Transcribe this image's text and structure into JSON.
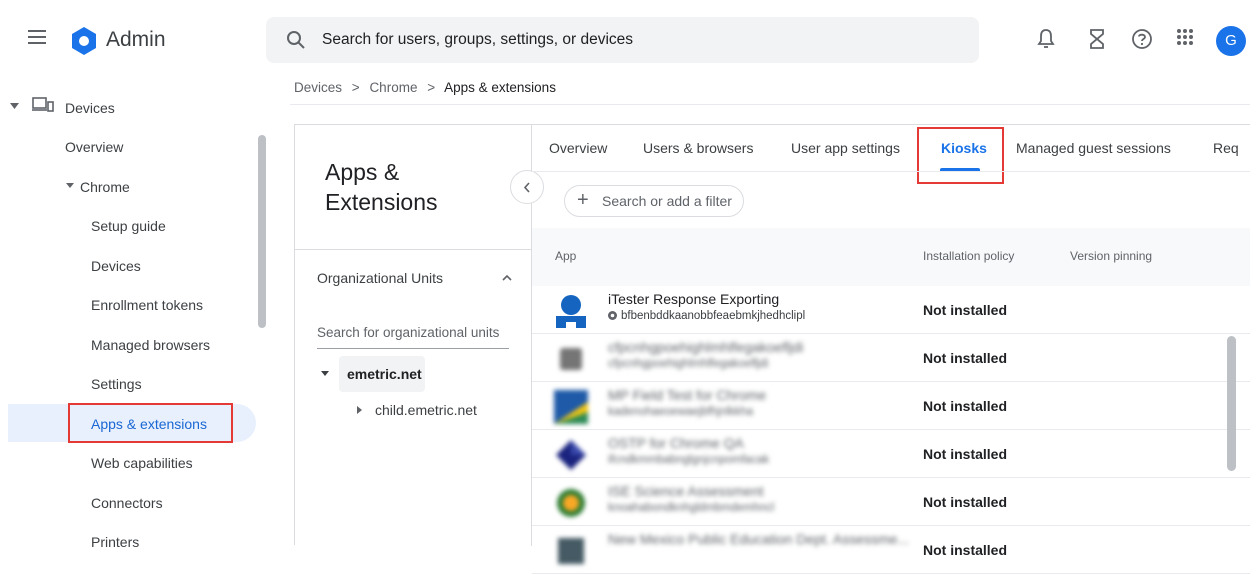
{
  "app": {
    "title": "Admin",
    "avatar_letter": "G"
  },
  "search": {
    "placeholder": "Search for users, groups, settings, or devices"
  },
  "breadcrumb": {
    "items": [
      "Devices",
      "Chrome"
    ],
    "current": "Apps & extensions",
    "separator": ">"
  },
  "sidebar": {
    "section": "Devices",
    "overview": "Overview",
    "chrome": "Chrome",
    "items": [
      "Setup guide",
      "Devices",
      "Enrollment tokens",
      "Managed browsers",
      "Settings",
      "Apps & extensions",
      "Web capabilities",
      "Connectors",
      "Printers"
    ],
    "active_index": 5
  },
  "panel": {
    "title": "Apps & Extensions",
    "ou_header": "Organizational Units",
    "ou_search_placeholder": "Search for organizational units",
    "ou_root": "emetric.net",
    "ou_child": "child.emetric.net"
  },
  "tabs": [
    {
      "label": "Overview"
    },
    {
      "label": "Users & browsers"
    },
    {
      "label": "User app settings"
    },
    {
      "label": "Kiosks",
      "active": true
    },
    {
      "label": "Managed guest sessions"
    },
    {
      "label": "Req"
    }
  ],
  "filter": {
    "label": "Search or add a filter"
  },
  "table": {
    "columns": [
      "App",
      "Installation policy",
      "Version pinning"
    ],
    "rows": [
      {
        "name": "iTester Response Exporting",
        "id": "bfbenbddkaanobbfeaebmkjhedhclipl",
        "policy": "Not installed",
        "icon": "itester-icon"
      },
      {
        "name": "cfpcnhgpoehighlmhlfegakoefljdi",
        "id": "cfpcnhgpoehighlmhlfegakoefljdi",
        "policy": "Not installed",
        "icon": "gray-app-icon"
      },
      {
        "name": "MP Field Test for Chrome",
        "id": "kadenohaeoewaejbfhjnlkkha",
        "policy": "Not installed",
        "icon": "field-test-icon"
      },
      {
        "name": "OSTP for Chrome QA",
        "id": "ifcndkmmbabnglgnjcnpomfacak",
        "policy": "Not installed",
        "icon": "diamond-app-icon"
      },
      {
        "name": "ISE Science Assessment",
        "id": "knoahabondknhgldmbmdemhncl",
        "policy": "Not installed",
        "icon": "science-app-icon"
      },
      {
        "name": "New Mexico Public Education Dept. Assessme...",
        "id": "",
        "policy": "Not installed",
        "icon": "nm-app-icon"
      }
    ]
  },
  "colors": {
    "accent": "#1a73e8",
    "highlight_box": "#e53935",
    "active_bg": "#e8f0fe"
  }
}
